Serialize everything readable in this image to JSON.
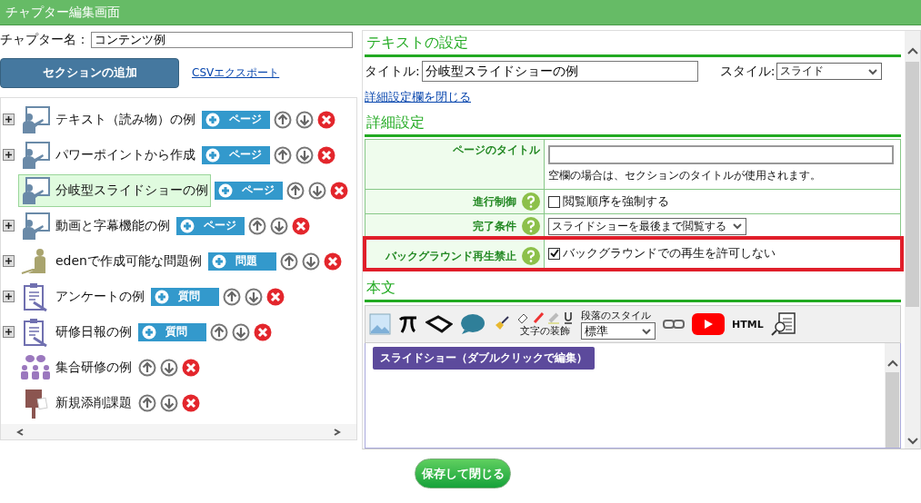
{
  "window": {
    "title": "チャプター編集画面"
  },
  "chapter_name": {
    "label": "チャプター名：",
    "value": "コンテンツ例"
  },
  "add_section_button": "セクションの追加",
  "csv_export_link": "CSVエクスポート",
  "tree": [
    {
      "kind": "slide",
      "label": "テキスト（読み物）の例",
      "expandable": true,
      "selected": false,
      "add_label": "ページ"
    },
    {
      "kind": "slide",
      "label": "パワーポイントから作成",
      "expandable": true,
      "selected": false,
      "add_label": "ページ"
    },
    {
      "kind": "slide",
      "label": "分岐型スライドショーの例",
      "expandable": false,
      "selected": true,
      "add_label": "ページ"
    },
    {
      "kind": "slide",
      "label": "動画と字幕機能の例",
      "expandable": true,
      "selected": false,
      "add_label": "ページ"
    },
    {
      "kind": "quiz",
      "label": "edenで作成可能な問題例",
      "expandable": true,
      "selected": false,
      "add_label": "問題"
    },
    {
      "kind": "survey",
      "label": "アンケートの例",
      "expandable": true,
      "selected": false,
      "add_label": "質問"
    },
    {
      "kind": "survey",
      "label": "研修日報の例",
      "expandable": true,
      "selected": false,
      "add_label": "質問"
    },
    {
      "kind": "group",
      "label": "集合研修の例",
      "expandable": false,
      "selected": false
    },
    {
      "kind": "post",
      "label": "新規添削課題",
      "expandable": false,
      "selected": false
    }
  ],
  "text_settings": {
    "heading": "テキストの設定",
    "title_label": "タイトル:",
    "title_value": "分岐型スライドショーの例",
    "style_label": "スタイル:",
    "style_value": "スライド"
  },
  "close_details_link": "詳細設定欄を閉じる",
  "details": {
    "heading": "詳細設定",
    "rows": [
      {
        "kind": "text",
        "label": "ページのタイトル",
        "help": false,
        "highlighted": false,
        "note": "空欄の場合は、セクションのタイトルが使用されます。"
      },
      {
        "kind": "checkbox",
        "label": "進行制御",
        "help": true,
        "highlighted": false,
        "checked": false,
        "option": "閲覧順序を強制する"
      },
      {
        "kind": "select",
        "label": "完了条件",
        "help": true,
        "highlighted": false,
        "value": "スライドショーを最後まで閲覧する"
      },
      {
        "kind": "checkbox",
        "label": "バックグラウンド再生禁止",
        "help": true,
        "highlighted": true,
        "checked": true,
        "option": "バックグラウンドでの再生を許可しない"
      }
    ]
  },
  "body": {
    "heading": "本文",
    "toolbar": {
      "decoration_label": "文字の装飾",
      "paragraph_label": "段落のスタイル",
      "paragraph_value": "標準",
      "html_button": "HTML"
    },
    "content_block": "スライドショー（ダブルクリックで編集）"
  },
  "save_button": "保存して閉じる"
}
